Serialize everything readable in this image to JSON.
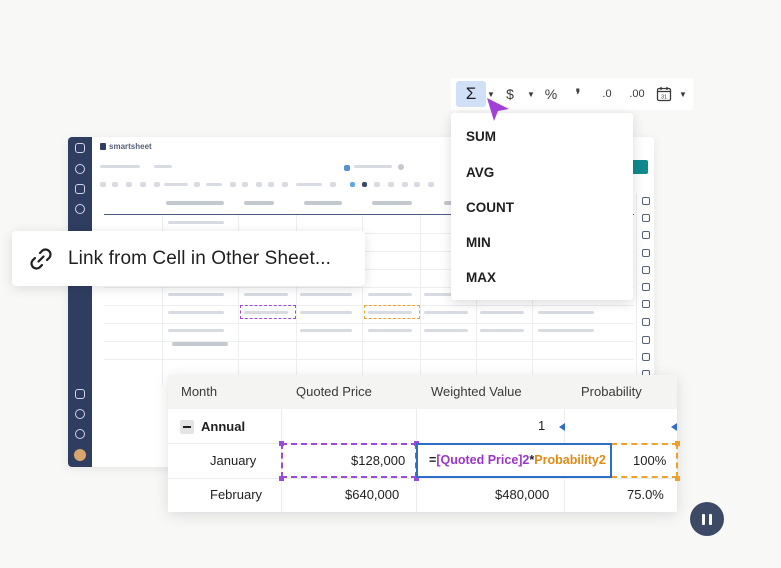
{
  "background_app": {
    "brand": "smartsheet"
  },
  "link_tooltip": {
    "label": "Link from Cell in Other Sheet..."
  },
  "toolbar": {
    "buttons": [
      {
        "name": "sum-icon",
        "glyph": "Σ"
      },
      {
        "name": "currency-icon",
        "glyph": "$"
      },
      {
        "name": "percent-icon",
        "glyph": "%"
      },
      {
        "name": "thousands-separator-icon",
        "glyph": "❜"
      },
      {
        "name": "decrease-decimal-icon",
        "glyph": ".0"
      },
      {
        "name": "increase-decimal-icon",
        "glyph": ".00"
      },
      {
        "name": "calendar-icon",
        "glyph": "31"
      }
    ]
  },
  "function_menu": {
    "items": [
      "SUM",
      "AVG",
      "COUNT",
      "MIN",
      "MAX"
    ]
  },
  "grid": {
    "columns": [
      "Month",
      "Quoted Price",
      "Weighted Value",
      "Probability"
    ],
    "rows": [
      {
        "month": "Annual",
        "quoted_price": "",
        "weighted_value": "1",
        "probability": ""
      },
      {
        "month": "January",
        "quoted_price": "$128,000",
        "weighted_value": "",
        "probability": "100%"
      },
      {
        "month": "February",
        "quoted_price": "$640,000",
        "weighted_value": "$480,000",
        "probability": "75.0%"
      }
    ],
    "formula": {
      "eq": "=",
      "ref1": "[Quoted Price]2",
      "op": "*",
      "ref2": "Probability2"
    }
  },
  "colors": {
    "formula_ref_purple": "#9b36c9",
    "formula_ref_orange": "#e08a17",
    "selection_blue": "#2f6ec8",
    "cursor_purple": "#a43fd6",
    "sidebar_navy": "#2f3d60"
  }
}
